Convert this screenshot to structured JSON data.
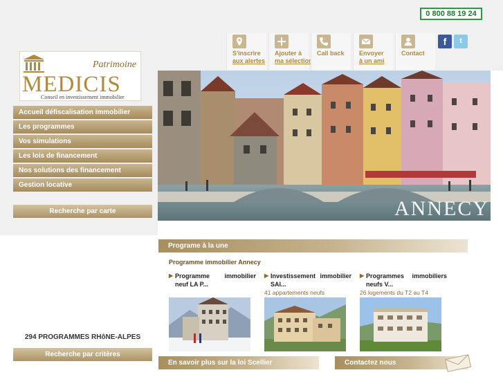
{
  "header": {
    "phone": "0 800 88 19 24",
    "top_links": [
      {
        "line1": "S'inscrire",
        "line2": "aux alertes",
        "icon": "location-pin-icon"
      },
      {
        "line1": "Ajouter à",
        "line2": "ma sélection",
        "icon": "plus-icon"
      },
      {
        "line1": "Call back",
        "line2": "",
        "icon": "phone-icon"
      },
      {
        "line1": "Envoyer",
        "line2": "à un ami",
        "icon": "envelope-icon"
      },
      {
        "line1": "Contact",
        "line2": "",
        "icon": "user-icon"
      }
    ],
    "social": {
      "facebook": "f",
      "twitter": "t"
    }
  },
  "logo": {
    "patrimoine": "Patrimoine",
    "name": "MEDICIS",
    "tagline": "Conseil en investissement immobilier"
  },
  "nav": {
    "items": [
      "Accueil défiscalisation immobilier",
      "Les programmes",
      "Vos simulations",
      "Les lois de financement",
      "Nos solutions des financement",
      "Gestion locative"
    ],
    "search_map": "Recherche par carte",
    "count": "294 PROGRAMMES RHôNE-ALPES",
    "search_criteria": "Recherche par critères"
  },
  "hero": {
    "city": "ANNECY"
  },
  "featured": {
    "bar": "Programe à la une",
    "title": "Programme immobilier Annecy",
    "cards": [
      {
        "title1": "Programme immobilier",
        "title2": "neuf LA P...",
        "subtitle": ""
      },
      {
        "title1": "Investissement immobilier",
        "title2": "SAI...",
        "subtitle": "41 appartements neufs"
      },
      {
        "title1": "Programmes immobiliers",
        "title2": "neufs V...",
        "subtitle": "26 logements du T2 au T4"
      }
    ]
  },
  "bottom": {
    "scellier": "En savoir plus sur la loi Scellier",
    "contact": "Contactez nous"
  },
  "colors": {
    "gold": "#b08a3a",
    "gold_bar": "#a88f5e",
    "phone_border": "#2a9a3e"
  }
}
